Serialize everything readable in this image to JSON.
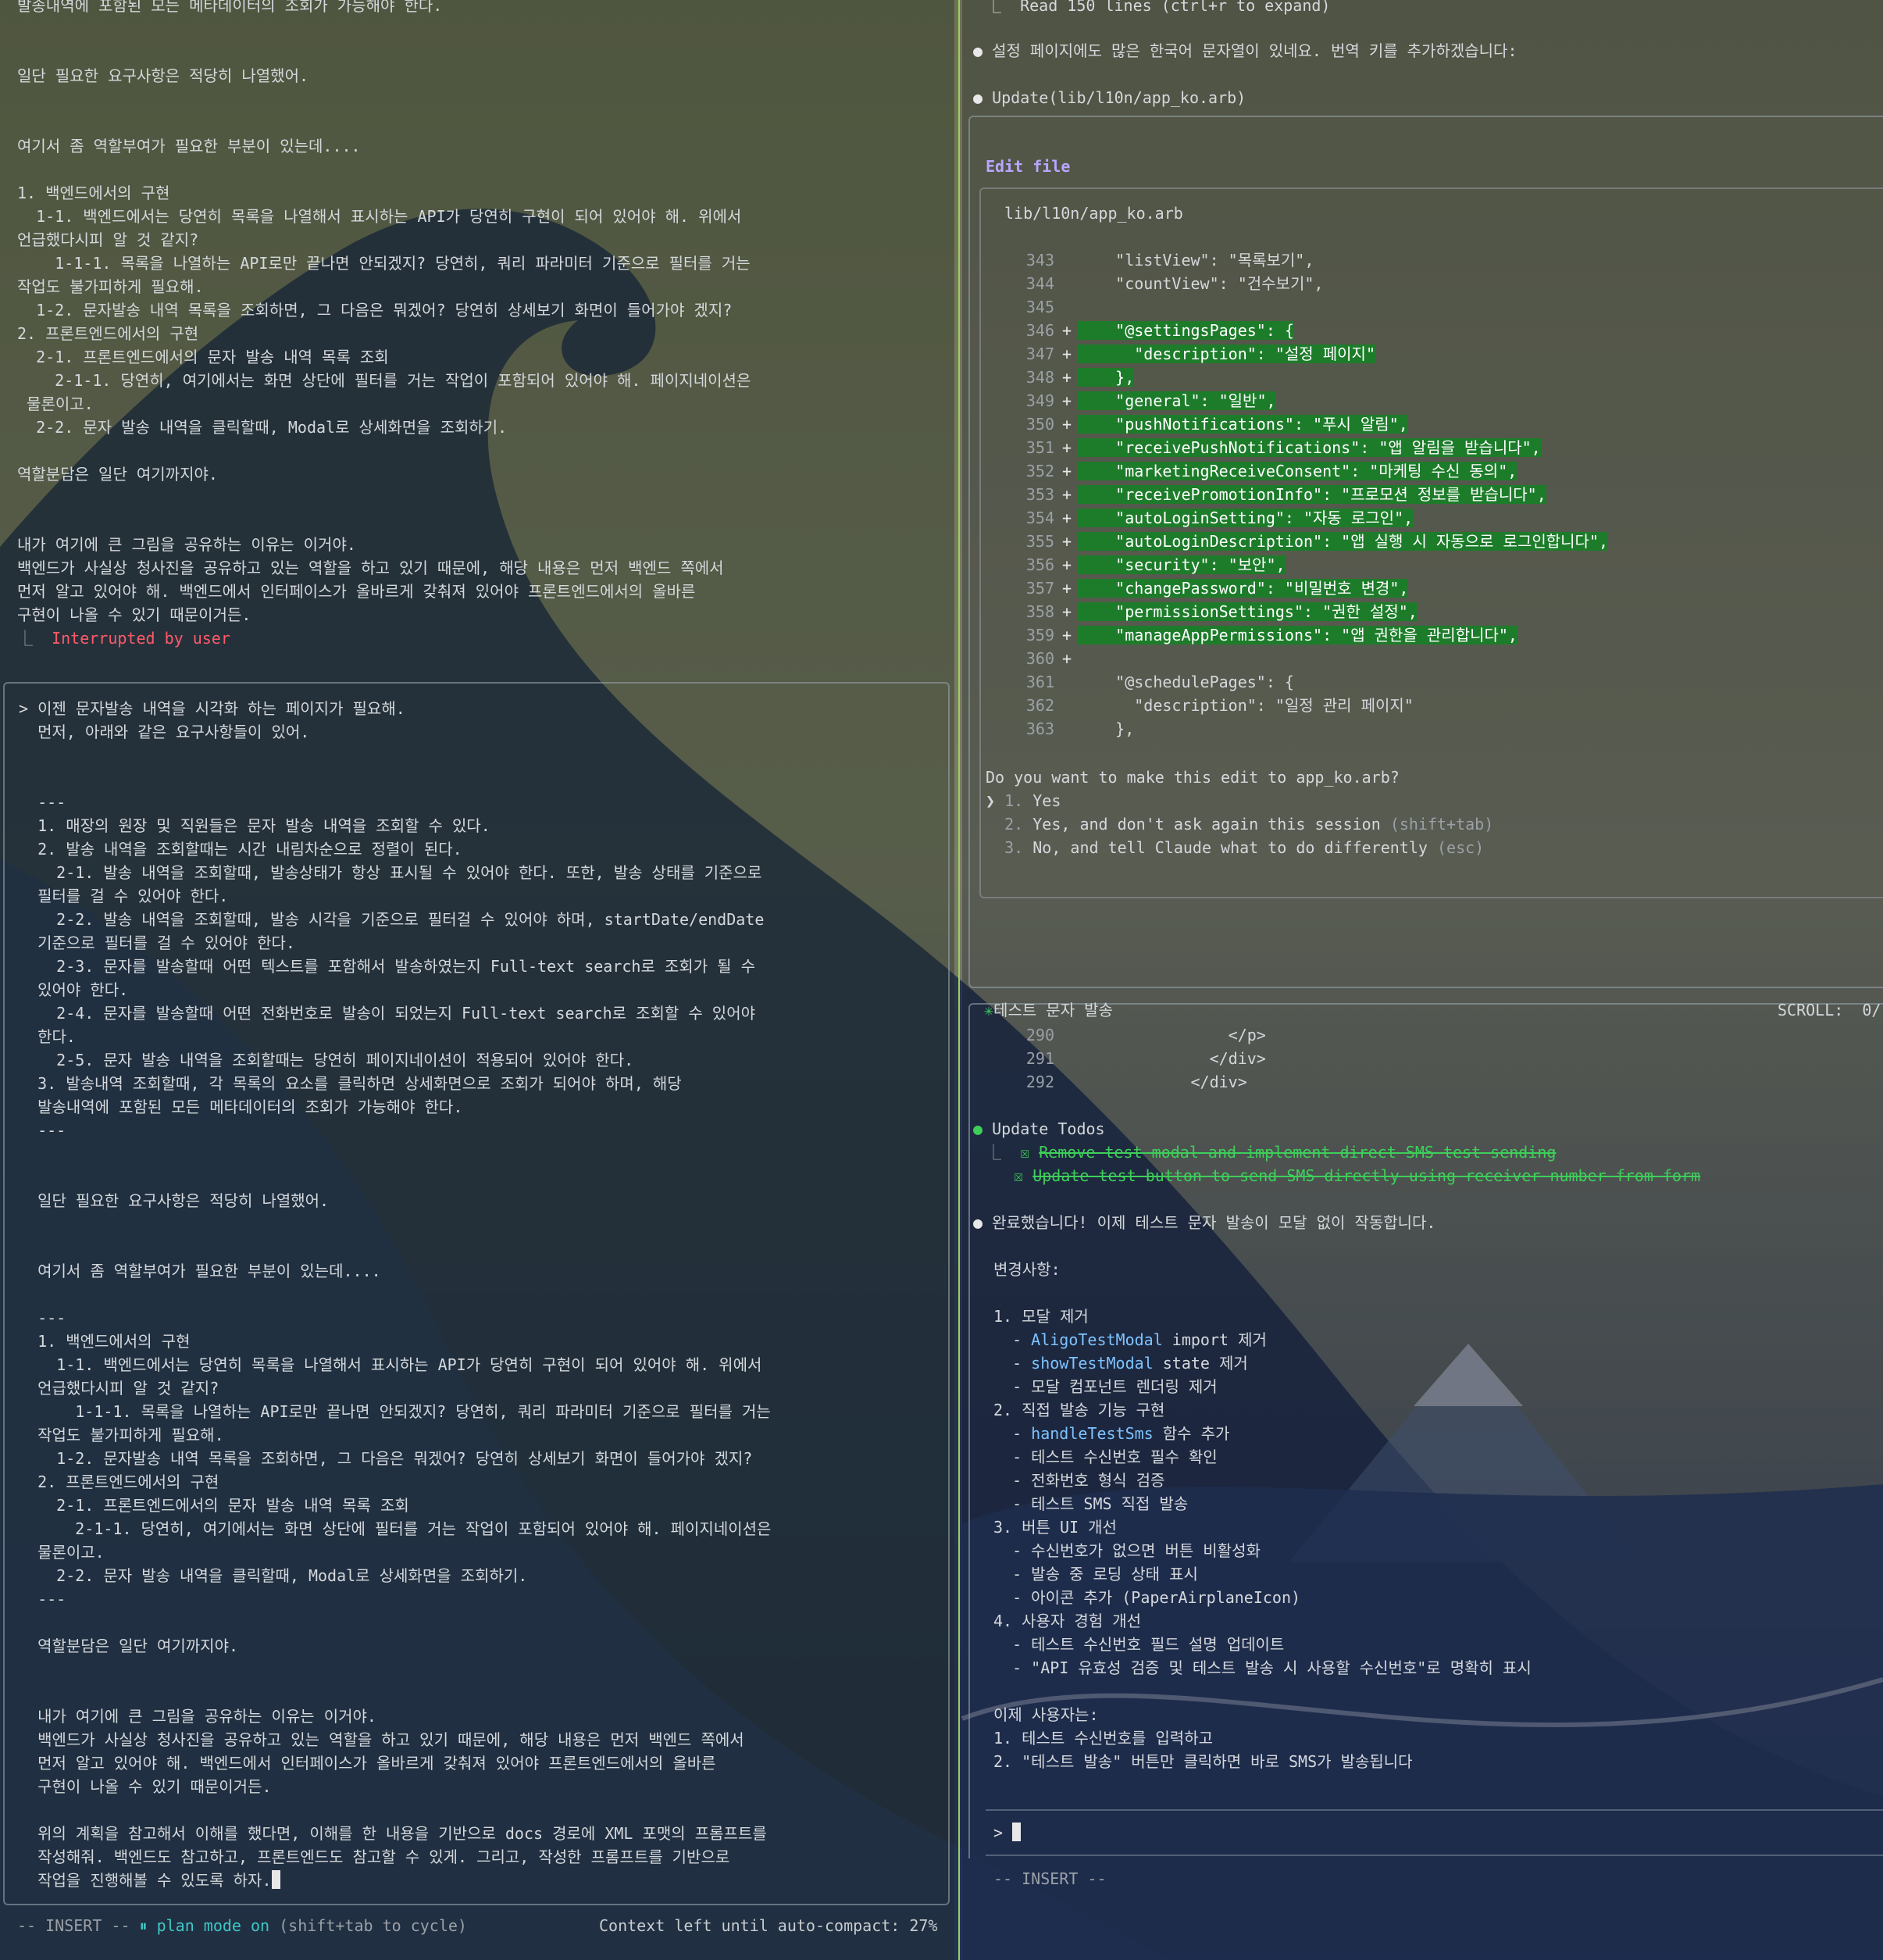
{
  "left": {
    "top_lines": [
      "발송내역에 포함된 모든 메타데이터의 조회가 가능해야 한다.",
      "",
      "",
      "일단 필요한 요구사항은 적당히 나열했어.",
      "",
      "",
      "여기서 좀 역할부여가 필요한 부분이 있는데....",
      "",
      "1. 백엔드에서의 구현",
      "  1-1. 백엔드에서는 당연히 목록을 나열해서 표시하는 API가 당연히 구현이 되어 있어야 해. 위에서",
      "언급했다시피 알 것 같지?",
      "    1-1-1. 목록을 나열하는 API로만 끝나면 안되겠지? 당연히, 쿼리 파라미터 기준으로 필터를 거는",
      "작업도 불가피하게 필요해.",
      "  1-2. 문자발송 내역 목록을 조회하면, 그 다음은 뭐겠어? 당연히 상세보기 화면이 들어가야 겠지?",
      "2. 프론트엔드에서의 구현",
      "  2-1. 프론트엔드에서의 문자 발송 내역 목록 조회",
      "    2-1-1. 당연히, 여기에서는 화면 상단에 필터를 거는 작업이 포함되어 있어야 해. 페이지네이션은",
      " 물론이고.",
      "  2-2. 문자 발송 내역을 클릭할때, Modal로 상세화면을 조회하기.",
      "",
      "역할분담은 일단 여기까지야.",
      "",
      "",
      "내가 여기에 큰 그림을 공유하는 이유는 이거야.",
      "백엔드가 사실상 청사진을 공유하고 있는 역할을 하고 있기 때문에, 해당 내용은 먼저 백엔드 쪽에서",
      "먼저 알고 있어야 해. 백엔드에서 인터페이스가 올바르게 갖춰져 있어야 프론트엔드에서의 올바른",
      "구현이 나올 수 있기 때문이거든."
    ],
    "interrupt_mark": "⎿",
    "interrupt_text": "Interrupted by user",
    "prompt_lines": [
      "> 이젠 문자발송 내역을 시각화 하는 페이지가 필요해.",
      "  먼저, 아래와 같은 요구사항들이 있어.",
      "",
      "",
      "  ---",
      "  1. 매장의 원장 및 직원들은 문자 발송 내역을 조회할 수 있다.",
      "  2. 발송 내역을 조회할때는 시간 내림차순으로 정렬이 된다.",
      "    2-1. 발송 내역을 조회할때, 발송상태가 항상 표시될 수 있어야 한다. 또한, 발송 상태를 기준으로",
      "  필터를 걸 수 있어야 한다.",
      "    2-2. 발송 내역을 조회할때, 발송 시각을 기준으로 필터걸 수 있어야 하며, startDate/endDate",
      "  기준으로 필터를 걸 수 있어야 한다.",
      "    2-3. 문자를 발송할때 어떤 텍스트를 포함해서 발송하였는지 Full-text search로 조회가 될 수",
      "  있어야 한다.",
      "    2-4. 문자를 발송할때 어떤 전화번호로 발송이 되었는지 Full-text search로 조회할 수 있어야",
      "  한다.",
      "    2-5. 문자 발송 내역을 조회할때는 당연히 페이지네이션이 적용되어 있어야 한다.",
      "  3. 발송내역 조회할때, 각 목록의 요소를 클릭하면 상세화면으로 조회가 되어야 하며, 해당",
      "  발송내역에 포함된 모든 메타데이터의 조회가 가능해야 한다.",
      "  ---",
      "",
      "",
      "  일단 필요한 요구사항은 적당히 나열했어.",
      "",
      "",
      "  여기서 좀 역할부여가 필요한 부분이 있는데....",
      "",
      "  ---",
      "  1. 백엔드에서의 구현",
      "    1-1. 백엔드에서는 당연히 목록을 나열해서 표시하는 API가 당연히 구현이 되어 있어야 해. 위에서",
      "  언급했다시피 알 것 같지?",
      "      1-1-1. 목록을 나열하는 API로만 끝나면 안되겠지? 당연히, 쿼리 파라미터 기준으로 필터를 거는",
      "  작업도 불가피하게 필요해.",
      "    1-2. 문자발송 내역 목록을 조회하면, 그 다음은 뭐겠어? 당연히 상세보기 화면이 들어가야 겠지?",
      "  2. 프론트엔드에서의 구현",
      "    2-1. 프론트엔드에서의 문자 발송 내역 목록 조회",
      "      2-1-1. 당연히, 여기에서는 화면 상단에 필터를 거는 작업이 포함되어 있어야 해. 페이지네이션은",
      "  물론이고.",
      "    2-2. 문자 발송 내역을 클릭할때, Modal로 상세화면을 조회하기.",
      "  ---",
      "",
      "  역할분담은 일단 여기까지야.",
      "",
      "",
      "  내가 여기에 큰 그림을 공유하는 이유는 이거야.",
      "  백엔드가 사실상 청사진을 공유하고 있는 역할을 하고 있기 때문에, 해당 내용은 먼저 백엔드 쪽에서",
      "  먼저 알고 있어야 해. 백엔드에서 인터페이스가 올바르게 갖춰져 있어야 프론트엔드에서의 올바른",
      "  구현이 나올 수 있기 때문이거든.",
      "",
      "  위의 계획을 참고해서 이해를 했다면, 이해를 한 내용을 기반으로 docs 경로에 XML 포맷의 프롬프트를",
      "  작성해줘. 백엔드도 참고하고, 프론트엔드도 참고할 수 있게. 그리고, 작성한 프롬프트를 기반으로",
      "  작업을 진행해볼 수 있도록 하자."
    ],
    "status_mode": "-- INSERT --",
    "status_plan_icon": "⏸",
    "status_plan": "plan mode on",
    "status_plan_hint": "(shift+tab to cycle)",
    "status_context": "Context left until auto-compact: 27%"
  },
  "right": {
    "read_line": "⎿  Read 150 lines (ctrl+r to expand)",
    "msg_settings": "설정 페이지에도 많은 한국어 문자열이 있네요. 번역 키를 추가하겠습니다:",
    "update_call": "Update(lib/l10n/app_ko.arb)",
    "edit_title": "Edit file",
    "file_path": "lib/l10n/app_ko.arb",
    "diff": [
      {
        "n": "343",
        "s": "",
        "code": "    \"listView\": \"목록보기\","
      },
      {
        "n": "344",
        "s": "",
        "code": "    \"countView\": \"건수보기\","
      },
      {
        "n": "345",
        "s": "",
        "code": ""
      },
      {
        "n": "346",
        "s": "+",
        "code": "    \"@settingsPages\": {"
      },
      {
        "n": "347",
        "s": "+",
        "code": "      \"description\": \"설정 페이지\""
      },
      {
        "n": "348",
        "s": "+",
        "code": "    },"
      },
      {
        "n": "349",
        "s": "+",
        "code": "    \"general\": \"일반\","
      },
      {
        "n": "350",
        "s": "+",
        "code": "    \"pushNotifications\": \"푸시 알림\","
      },
      {
        "n": "351",
        "s": "+",
        "code": "    \"receivePushNotifications\": \"앱 알림을 받습니다\","
      },
      {
        "n": "352",
        "s": "+",
        "code": "    \"marketingReceiveConsent\": \"마케팅 수신 동의\","
      },
      {
        "n": "353",
        "s": "+",
        "code": "    \"receivePromotionInfo\": \"프로모션 정보를 받습니다\","
      },
      {
        "n": "354",
        "s": "+",
        "code": "    \"autoLoginSetting\": \"자동 로그인\","
      },
      {
        "n": "355",
        "s": "+",
        "code": "    \"autoLoginDescription\": \"앱 실행 시 자동으로 로그인합니다\","
      },
      {
        "n": "356",
        "s": "+",
        "code": "    \"security\": \"보안\","
      },
      {
        "n": "357",
        "s": "+",
        "code": "    \"changePassword\": \"비밀번호 변경\","
      },
      {
        "n": "358",
        "s": "+",
        "code": "    \"permissionSettings\": \"권한 설정\","
      },
      {
        "n": "359",
        "s": "+",
        "code": "    \"manageAppPermissions\": \"앱 권한을 관리합니다\","
      },
      {
        "n": "360",
        "s": "+",
        "code": ""
      },
      {
        "n": "361",
        "s": "",
        "code": "    \"@schedulePages\": {"
      },
      {
        "n": "362",
        "s": "",
        "code": "      \"description\": \"일정 관리 페이지\""
      },
      {
        "n": "363",
        "s": "",
        "code": "    },"
      }
    ],
    "question": "Do you want to make this edit to app_ko.arb?",
    "options": [
      {
        "marker": "❯",
        "num": "1.",
        "label": "Yes",
        "hint": ""
      },
      {
        "marker": " ",
        "num": "2.",
        "label": "Yes, and don't ask again this session",
        "hint": "(shift+tab)"
      },
      {
        "marker": " ",
        "num": "3.",
        "label": "No, and tell Claude what to do differently",
        "hint": "(esc)"
      }
    ],
    "test_star": "✳",
    "test_title": "테스트 문자 발송",
    "scroll_label": "SCROLL:  0/",
    "code_lines": [
      {
        "n": "290",
        "code": "                </p>"
      },
      {
        "n": "291",
        "code": "              </div>"
      },
      {
        "n": "292",
        "code": "            </div>"
      }
    ],
    "update_todos": "Update Todos",
    "todos": [
      "Remove test modal and implement direct SMS test sending",
      "Update test button to send SMS directly using receiver number from form"
    ],
    "done_msg": "완료했습니다! 이제 테스트 문자 발송이 모달 없이 작동합니다.",
    "changes_title": "변경사항:",
    "changes": [
      {
        "t": "1. 모달 제거",
        "code": "",
        "rest": ""
      },
      {
        "t": "  - ",
        "code": "AligoTestModal",
        "rest": " import 제거"
      },
      {
        "t": "  - ",
        "code": "showTestModal",
        "rest": " state 제거"
      },
      {
        "t": "  - 모달 컴포넌트 렌더링 제거",
        "code": "",
        "rest": ""
      },
      {
        "t": "2. 직접 발송 기능 구현",
        "code": "",
        "rest": ""
      },
      {
        "t": "  - ",
        "code": "handleTestSms",
        "rest": " 함수 추가"
      },
      {
        "t": "  - 테스트 수신번호 필수 확인",
        "code": "",
        "rest": ""
      },
      {
        "t": "  - 전화번호 형식 검증",
        "code": "",
        "rest": ""
      },
      {
        "t": "  - 테스트 SMS 직접 발송",
        "code": "",
        "rest": ""
      },
      {
        "t": "3. 버튼 UI 개선",
        "code": "",
        "rest": ""
      },
      {
        "t": "  - 수신번호가 없으면 버튼 비활성화",
        "code": "",
        "rest": ""
      },
      {
        "t": "  - 발송 중 로딩 상태 표시",
        "code": "",
        "rest": ""
      },
      {
        "t": "  - 아이콘 추가 (PaperAirplaneIcon)",
        "code": "",
        "rest": ""
      },
      {
        "t": "4. 사용자 경험 개선",
        "code": "",
        "rest": ""
      },
      {
        "t": "  - 테스트 수신번호 필드 설명 업데이트",
        "code": "",
        "rest": ""
      },
      {
        "t": "  - \"API 유효성 검증 및 테스트 발송 시 사용할 수신번호\"로 명확히 표시",
        "code": "",
        "rest": ""
      }
    ],
    "now_title": "이제 사용자는:",
    "now_items": [
      "1. 테스트 수신번호를 입력하고",
      "2. \"테스트 발송\" 버튼만 클릭하면 바로 SMS가 발송됩니다"
    ],
    "prompt_char": ">",
    "status_mode": "-- INSERT --"
  }
}
